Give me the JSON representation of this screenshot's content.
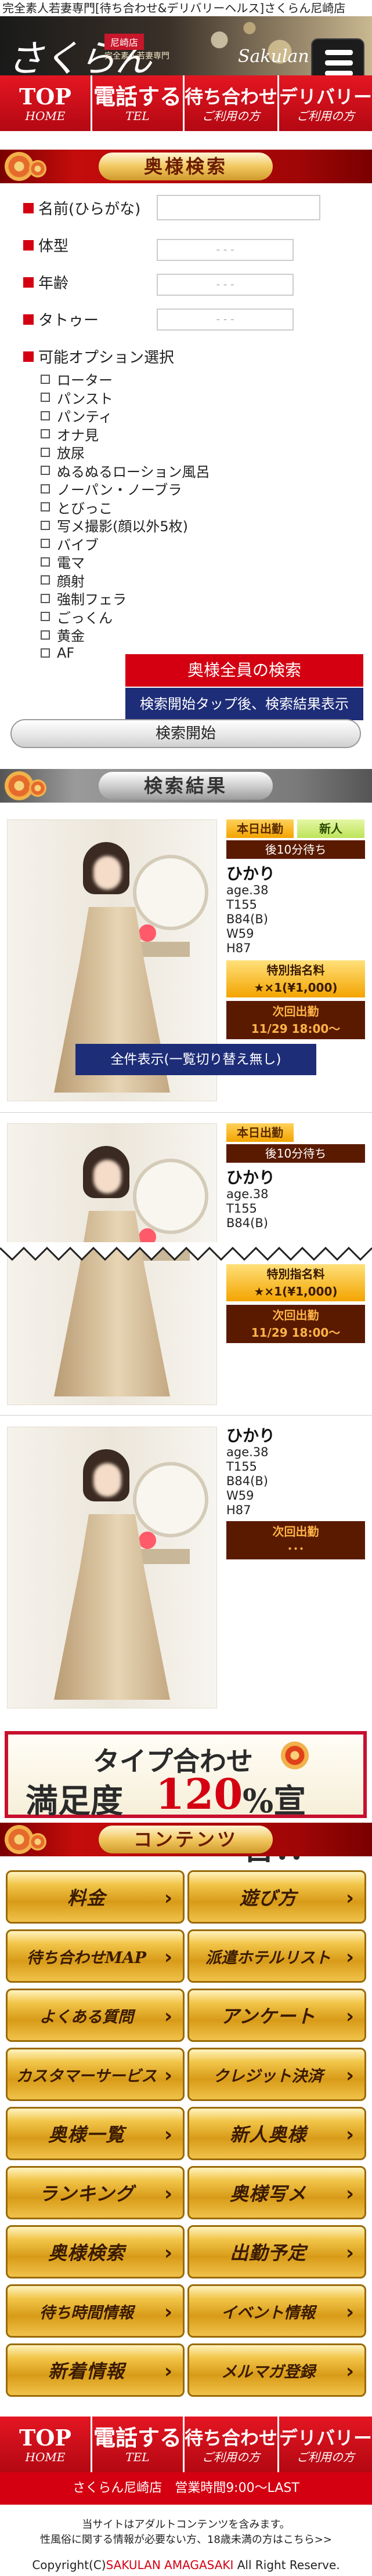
{
  "header": {
    "tagline": "完全素人若妻専門[待ち合わせ&デリバリーヘルス]さくらん尼崎店",
    "logo_main": "さくらん",
    "logo_area": "尼崎店",
    "logo_sub": "完全素人若妻専門",
    "logo_script": "Sakulan",
    "menu_icon": "hamburger-icon"
  },
  "nav": [
    {
      "main": "TOP",
      "sub": "HOME"
    },
    {
      "main": "電話する",
      "sub": "TEL"
    },
    {
      "main": "待ち合わせ",
      "sub": "ご利用の方"
    },
    {
      "main": "デリバリー",
      "sub": "ご利用の方"
    }
  ],
  "search": {
    "title": "奥様検索",
    "name_label": "名前(ひらがな)",
    "name_value": "",
    "body_label": "体型",
    "body_value": "- - -",
    "age_label": "年齢",
    "age_value": "- - -",
    "tattoo_label": "タトゥー",
    "tattoo_value": "- - -",
    "options_label": "可能オプション選択",
    "options": [
      "ローター",
      "パンスト",
      "パンティ",
      "オナ見",
      "放尿",
      "ぬるぬるローション風呂",
      "ノーパン・ノーブラ",
      "とびっこ",
      "写メ撮影(顔以外5枚)",
      "バイブ",
      "電マ",
      "顔射",
      "強制フェラ",
      "ごっくん",
      "黄金",
      "AF"
    ],
    "tooltip_all": "奥様全員の検索",
    "tooltip_hint": "検索開始タップ後、検索結果表示",
    "submit_label": "検索開始"
  },
  "results": {
    "title": "検索結果",
    "full_view_label": "全件表示(一覧切り替え無し)",
    "cards": [
      {
        "badge_today": "本日出勤",
        "badge_new": "新人",
        "wait": "後10分待ち",
        "name": "ひかり",
        "age": "age.38",
        "height": "T155",
        "bust": "B84(B)",
        "waist": "W59",
        "hip": "H87",
        "nom_title": "特別指名料",
        "nom_value": "★×1(¥1,000)",
        "next_title": "次回出勤",
        "next_value": "11/29 18:00～"
      },
      {
        "badge_today": "本日出勤",
        "wait": "後10分待ち",
        "name": "ひかり",
        "age": "age.38",
        "height": "T155",
        "bust": "B84(B)",
        "nom_title": "特別指名料",
        "nom_value": "★×1(¥1,000)",
        "next_title": "次回出勤",
        "next_value": "11/29 18:00～"
      },
      {
        "name": "ひかり",
        "age": "age.38",
        "height": "T155",
        "bust": "B84(B)",
        "waist": "W59",
        "hip": "H87",
        "next_title": "次回出勤",
        "next_value": "･･･"
      }
    ]
  },
  "promo": {
    "line1": "タイプ合わせ",
    "line2a": "満足度",
    "line2b": "120",
    "line2c": "%宣言!!"
  },
  "contents": {
    "title": "コンテンツ",
    "items": [
      "料金",
      "遊び方",
      "待ち合わせMAP",
      "派遣ホテルリスト",
      "よくある質問",
      "アンケート",
      "カスタマーサービス",
      "クレジット決済",
      "奥様一覧",
      "新人奥様",
      "ランキング",
      "奥様写メ",
      "奥様検索",
      "出勤予定",
      "待ち時間情報",
      "イベント情報",
      "新着情報",
      "メルマガ登録"
    ]
  },
  "footer": {
    "shop_hours": "さくらん尼崎店　営業時間9:00～LAST",
    "notice1": "当サイトはアダルトコンテンツを含みます。",
    "notice2": "性風俗に関する情報が必要ない方、18歳未満の方はこちら>>",
    "copy_prefix": "Copyright(C)",
    "copy_brand": "SAKULAN AMAGASAKI",
    "copy_suffix": " All Right Reserve."
  },
  "colors": {
    "brand_red": "#d40012",
    "navy": "#1e2d78",
    "gold": "#f2c64a",
    "dark_brown": "#5a1a00"
  }
}
